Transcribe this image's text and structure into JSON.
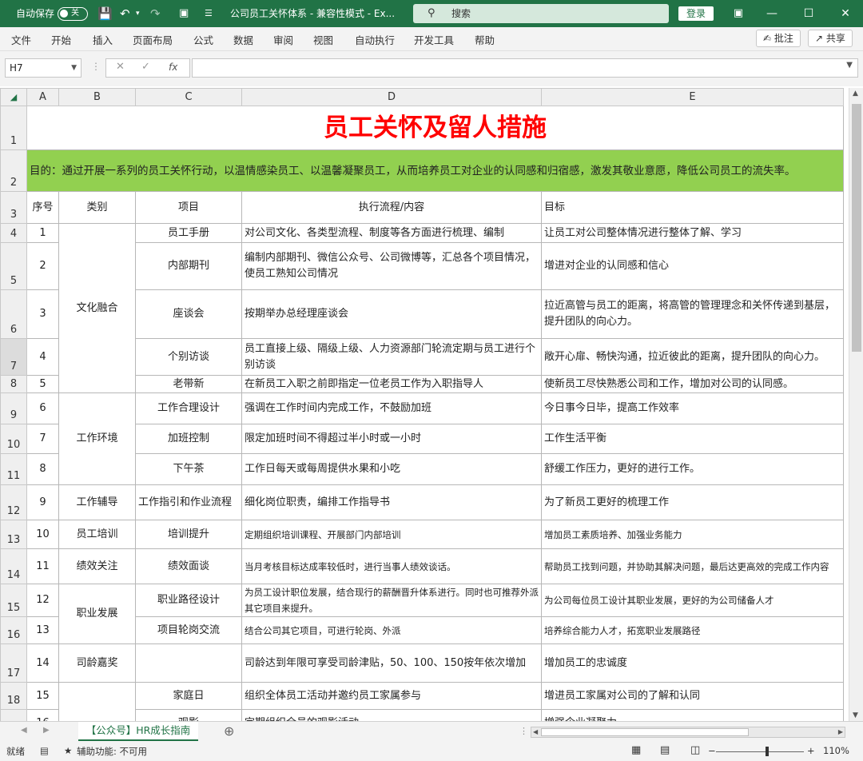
{
  "titlebar": {
    "autosave_label": "自动保存",
    "autosave_state": "关",
    "doc_title": "公司员工关怀体系 - 兼容性模式 - Ex...",
    "search_placeholder": "搜索",
    "login_label": "登录"
  },
  "menu": {
    "items": [
      "文件",
      "开始",
      "插入",
      "页面布局",
      "公式",
      "数据",
      "审阅",
      "视图",
      "自动执行",
      "开发工具",
      "帮助"
    ],
    "comment_label": "批注",
    "share_label": "共享"
  },
  "formula": {
    "cell_ref": "H7",
    "fx": "fx",
    "value": ""
  },
  "columns": [
    "A",
    "B",
    "C",
    "D",
    "E"
  ],
  "sheet": {
    "title": "员工关怀及留人措施",
    "purpose": "目的：通过开展一系列的员工关怀行动，以温情感染员工、以温馨凝聚员工，从而培养员工对企业的认同感和归宿感，激发其敬业意愿，降低公司员工的流失率。",
    "headers": {
      "no": "序号",
      "category": "类别",
      "item": "项目",
      "process": "执行流程/内容",
      "goal": "目标"
    },
    "categories": {
      "culture": "文化融合",
      "environment": "工作环境",
      "guidance": "工作辅导",
      "training": "员工培训",
      "performance": "绩效关注",
      "career": "职业发展",
      "seniority": "司龄嘉奖"
    },
    "rows": [
      {
        "row": "4",
        "no": "1",
        "item": "员工手册",
        "process": "对公司文化、各类型流程、制度等各方面进行梳理、编制",
        "goal": "让员工对公司整体情况进行整体了解、学习"
      },
      {
        "row": "5",
        "no": "2",
        "item": "内部期刊",
        "process": "编制内部期刊、微信公众号、公司微博等，汇总各个项目情况，使员工熟知公司情况",
        "goal": "增进对企业的认同感和信心"
      },
      {
        "row": "6",
        "no": "3",
        "item": "座谈会",
        "process": "按期举办总经理座谈会",
        "goal": "拉近高管与员工的距离，将高管的管理理念和关怀传递到基层，提升团队的向心力。"
      },
      {
        "row": "7",
        "no": "4",
        "item": "个别访谈",
        "process": "员工直接上级、隔级上级、人力资源部门轮流定期与员工进行个别访谈",
        "goal": "敞开心扉、畅快沟通，拉近彼此的距离，提升团队的向心力。"
      },
      {
        "row": "8",
        "no": "5",
        "item": "老带新",
        "process": "在新员工入职之前即指定一位老员工作为入职指导人",
        "goal": "使新员工尽快熟悉公司和工作，增加对公司的认同感。"
      },
      {
        "row": "9",
        "no": "6",
        "item": "工作合理设计",
        "process": "强调在工作时间内完成工作，不鼓励加班",
        "goal": "今日事今日毕，提高工作效率"
      },
      {
        "row": "10",
        "no": "7",
        "item": "加班控制",
        "process": "限定加班时间不得超过半小时或一小时",
        "goal": "工作生活平衡"
      },
      {
        "row": "11",
        "no": "8",
        "item": "下午茶",
        "process": "工作日每天或每周提供水果和小吃",
        "goal": "舒缓工作压力，更好的进行工作。"
      },
      {
        "row": "12",
        "no": "9",
        "item": "工作指引和作业流程",
        "process": "细化岗位职责，编排工作指导书",
        "goal": "为了新员工更好的梳理工作"
      },
      {
        "row": "13",
        "no": "10",
        "item": "培训提升",
        "process": "定期组织培训课程、开展部门内部培训",
        "goal": "增加员工素质培养、加强业务能力"
      },
      {
        "row": "14",
        "no": "11",
        "item": "绩效面谈",
        "process": "当月考核目标达成率较低时，进行当事人绩效谈话。",
        "goal": "帮助员工找到问题，并协助其解决问题，最后达更高效的完成工作内容"
      },
      {
        "row": "15",
        "no": "12",
        "item": "职业路径设计",
        "process": "为员工设计职位发展，结合现行的薪酬晋升体系进行。同时也可推荐外派其它项目来提升。",
        "goal": "为公司每位员工设计其职业发展，更好的为公司储备人才"
      },
      {
        "row": "16",
        "no": "13",
        "item": "项目轮岗交流",
        "process": "结合公司其它项目，可进行轮岗、外派",
        "goal": "培养综合能力人才，拓宽职业发展路径"
      },
      {
        "row": "17",
        "no": "14",
        "item": "",
        "process": "司龄达到年限可享受司龄津贴，50、100、150按年依次增加",
        "goal": "增加员工的忠诚度"
      },
      {
        "row": "18",
        "no": "15",
        "item": "家庭日",
        "process": "组织全体员工活动并邀约员工家属参与",
        "goal": "增进员工家属对公司的了解和认同"
      },
      {
        "row": "19",
        "no": "16",
        "item": "观影",
        "process": "定期组织全员的观影活动",
        "goal": "增强企业凝聚力"
      }
    ]
  },
  "sheet_tab": "【公众号】HR成长指南",
  "status": {
    "ready": "就绪",
    "accessibility": "辅助功能: 不可用",
    "zoom": "110%"
  }
}
